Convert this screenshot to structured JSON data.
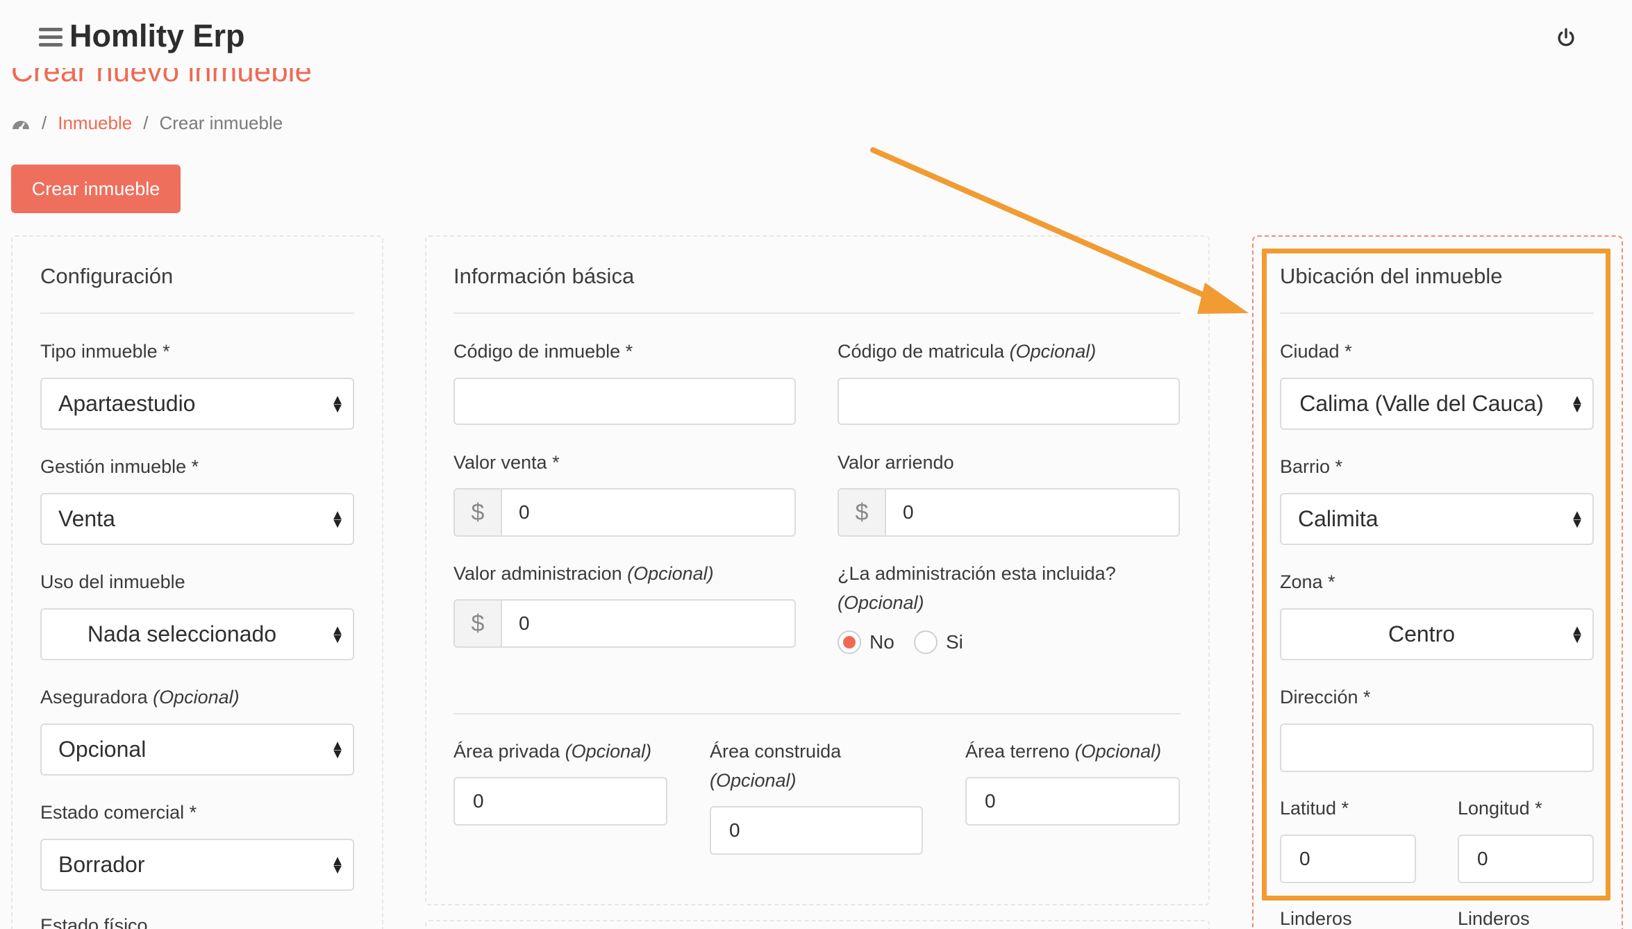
{
  "header": {
    "app_title": "Homlity Erp",
    "menu_icon": "hamburger-icon",
    "power_icon": "power-icon"
  },
  "page": {
    "title": "Crear nuevo inmueble"
  },
  "breadcrumb": {
    "home_icon": "dashboard-icon",
    "link": "Inmueble",
    "current": "Crear inmueble",
    "separator": "/"
  },
  "actions": {
    "create_button": "Crear inmueble"
  },
  "config": {
    "title": "Configuración",
    "tipo_label": "Tipo inmueble *",
    "tipo_value": "Apartaestudio",
    "gestion_label": "Gestión inmueble *",
    "gestion_value": "Venta",
    "uso_label": "Uso del inmueble",
    "uso_value": "Nada seleccionado",
    "aseguradora_label": "Aseguradora",
    "aseguradora_opt": "(Opcional)",
    "aseguradora_value": "Opcional",
    "estado_label": "Estado comercial *",
    "estado_value": "Borrador",
    "estado_fisico_label": "Estado físico"
  },
  "basic": {
    "title": "Información básica",
    "codigo_label": "Código de inmueble *",
    "codigo_value": "",
    "matricula_label": "Código de matricula",
    "matricula_opt": "(Opcional)",
    "matricula_value": "",
    "venta_label": "Valor venta *",
    "venta_value": "0",
    "arriendo_label": "Valor arriendo",
    "arriendo_value": "0",
    "admin_label": "Valor administracion",
    "admin_opt": "(Opcional)",
    "admin_value": "0",
    "incluida_label": "¿La administración esta incluida?",
    "incluida_opt": "(Opcional)",
    "radio_no": "No",
    "radio_si": "Si",
    "radio_selected": "No",
    "currency": "$",
    "area_privada_label": "Área privada",
    "area_privada_opt": "(Opcional)",
    "area_privada_value": "0",
    "area_construida_label": "Área construida",
    "area_construida_opt": "(Opcional)",
    "area_construida_value": "0",
    "area_terreno_label": "Área terreno",
    "area_terreno_opt": "(Opcional)",
    "area_terreno_value": "0"
  },
  "location": {
    "title": "Ubicación del inmueble",
    "ciudad_label": "Ciudad *",
    "ciudad_value": "Calima (Valle del Cauca)",
    "barrio_label": "Barrio *",
    "barrio_value": "Calimita",
    "zona_label": "Zona *",
    "zona_value": "Centro",
    "direccion_label": "Dirección *",
    "direccion_value": "",
    "latitud_label": "Latitud *",
    "latitud_value": "0",
    "longitud_label": "Longitud *",
    "longitud_value": "0",
    "linderos_1": "Linderos",
    "linderos_2": "Linderos"
  },
  "annotation": {
    "arrow_color": "#f19b32",
    "highlight_color": "#f19b32"
  }
}
